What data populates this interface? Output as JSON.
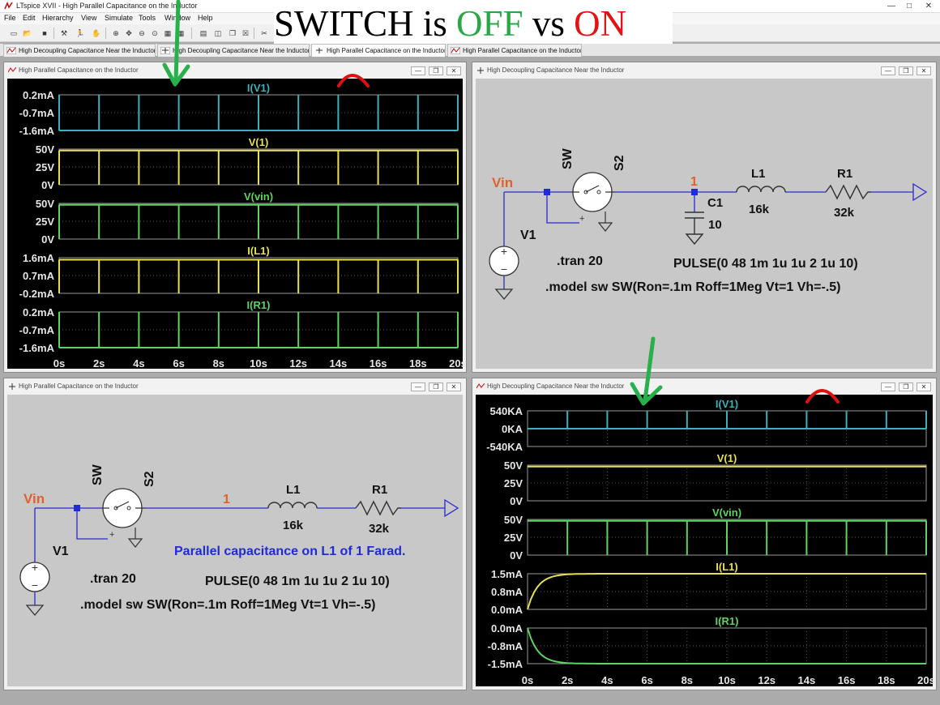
{
  "app": {
    "window_title": "LTspice XVII - High Parallel Capacitance on the Inductor",
    "menu": [
      "File",
      "Edit",
      "Hierarchy",
      "View",
      "Simulate",
      "Tools",
      "Window",
      "Help"
    ],
    "tabs": [
      "High Decoupling Capacitance Near the Inductor",
      "High Decoupling Capacitance Near the Inductor",
      "High Parallel Capacitance on the Inductor",
      "High Parallel Capacitance on the Inductor"
    ],
    "active_tab_index": 2
  },
  "headline": {
    "part1": "SWITCH is ",
    "off": "OFF",
    "part2": " vs ",
    "on": "ON"
  },
  "colors": {
    "off": "#28a745",
    "on": "#e01414",
    "arrow": "#28b04a",
    "mark": "#dd1111"
  },
  "windows": {
    "top_left": {
      "title": "High Parallel Capacitance on the Inductor",
      "kind": "waveform"
    },
    "top_right": {
      "title": "High Decoupling Capacitance Near the Inductor",
      "kind": "schematic"
    },
    "bottom_left": {
      "title": "High Parallel Capacitance on the Inductor",
      "kind": "schematic"
    },
    "bottom_right": {
      "title": "High Decoupling Capacitance Near the Inductor",
      "kind": "waveform"
    }
  },
  "schem_top": {
    "vin": "Vin",
    "sw": "SW",
    "s2": "S2",
    "node1": "1",
    "c1": "C1",
    "c1val": "10",
    "l1": "L1",
    "l1val": "16k",
    "r1": "R1",
    "r1val": "32k",
    "v1": "V1",
    "tran": ".tran 20",
    "pulse": "PULSE(0 48 1m 1u 1u 2 1u 10)",
    "model": ".model sw SW(Ron=.1m Roff=1Meg Vt=1 Vh=-.5)"
  },
  "schem_bottom": {
    "vin": "Vin",
    "sw": "SW",
    "s2": "S2",
    "node1": "1",
    "l1": "L1",
    "l1val": "16k",
    "r1": "R1",
    "r1val": "32k",
    "v1": "V1",
    "note": "Parallel capacitance on L1 of 1 Farad.",
    "tran": ".tran 20",
    "pulse": "PULSE(0 48 1m 1u 1u 2 1u 10)",
    "model": ".model sw SW(Ron=.1m Roff=1Meg Vt=1 Vh=-.5)"
  },
  "chart_data": [
    {
      "type": "line",
      "panel": "top_left",
      "x_ticks": [
        "0s",
        "2s",
        "4s",
        "6s",
        "8s",
        "10s",
        "12s",
        "14s",
        "16s",
        "18s",
        "20s"
      ],
      "xlim": [
        0,
        20
      ],
      "pulse_times": [
        0,
        2,
        4,
        6,
        8,
        10,
        12,
        14,
        16,
        18,
        20
      ],
      "plots": [
        {
          "name": "I(V1)",
          "color": "#3fb0b8",
          "y_ticks": [
            "0.2mA",
            "-0.7mA",
            "-1.6mA"
          ],
          "ylim": [
            -1.6,
            0.2
          ],
          "unit": "mA",
          "baseline": -1.6,
          "spike_to": 0.2
        },
        {
          "name": "V(1)",
          "color": "#e8e050",
          "y_ticks": [
            "50V",
            "25V",
            "0V"
          ],
          "ylim": [
            0,
            50
          ],
          "unit": "V",
          "baseline": 48,
          "spike_to": 0
        },
        {
          "name": "V(vin)",
          "color": "#5fd35f",
          "y_ticks": [
            "50V",
            "25V",
            "0V"
          ],
          "ylim": [
            0,
            50
          ],
          "unit": "V",
          "baseline": 48,
          "spike_to": 0
        },
        {
          "name": "I(L1)",
          "color": "#e8e050",
          "y_ticks": [
            "1.6mA",
            "0.7mA",
            "-0.2mA"
          ],
          "ylim": [
            -0.2,
            1.6
          ],
          "unit": "mA",
          "baseline": 1.5,
          "spike_to": -0.2
        },
        {
          "name": "I(R1)",
          "color": "#5fd35f",
          "y_ticks": [
            "0.2mA",
            "-0.7mA",
            "-1.6mA"
          ],
          "ylim": [
            -1.6,
            0.2
          ],
          "unit": "mA",
          "baseline": -1.6,
          "spike_to": 0.2
        }
      ]
    },
    {
      "type": "line",
      "panel": "bottom_right",
      "x_ticks": [
        "0s",
        "2s",
        "4s",
        "6s",
        "8s",
        "10s",
        "12s",
        "14s",
        "16s",
        "18s",
        "20s"
      ],
      "xlim": [
        0,
        20
      ],
      "pulse_times": [
        2,
        4,
        6,
        8,
        10,
        12,
        14,
        16,
        18,
        20
      ],
      "plots": [
        {
          "name": "I(V1)",
          "color": "#3fb0b8",
          "y_ticks": [
            "540KA",
            "0KA",
            "-540KA"
          ],
          "ylim": [
            -540,
            540
          ],
          "unit": "KA",
          "baseline": 0,
          "spike_to": 540
        },
        {
          "name": "V(1)",
          "color": "#e8e050",
          "y_ticks": [
            "50V",
            "25V",
            "0V"
          ],
          "ylim": [
            0,
            50
          ],
          "unit": "V",
          "baseline": 48,
          "spike_to": null
        },
        {
          "name": "V(vin)",
          "color": "#5fd35f",
          "y_ticks": [
            "50V",
            "25V",
            "0V"
          ],
          "ylim": [
            0,
            50
          ],
          "unit": "V",
          "baseline": 48,
          "spike_to": 0
        },
        {
          "name": "I(L1)",
          "color": "#e8e050",
          "y_ticks": [
            "1.5mA",
            "0.8mA",
            "0.0mA"
          ],
          "ylim": [
            0,
            1.5
          ],
          "unit": "mA",
          "curve": "rise",
          "final": 1.5,
          "tau": 0.5
        },
        {
          "name": "I(R1)",
          "color": "#5fd35f",
          "y_ticks": [
            "0.0mA",
            "-0.8mA",
            "-1.5mA"
          ],
          "ylim": [
            -1.5,
            0
          ],
          "unit": "mA",
          "curve": "fall",
          "final": -1.5,
          "tau": 0.5
        }
      ]
    }
  ]
}
